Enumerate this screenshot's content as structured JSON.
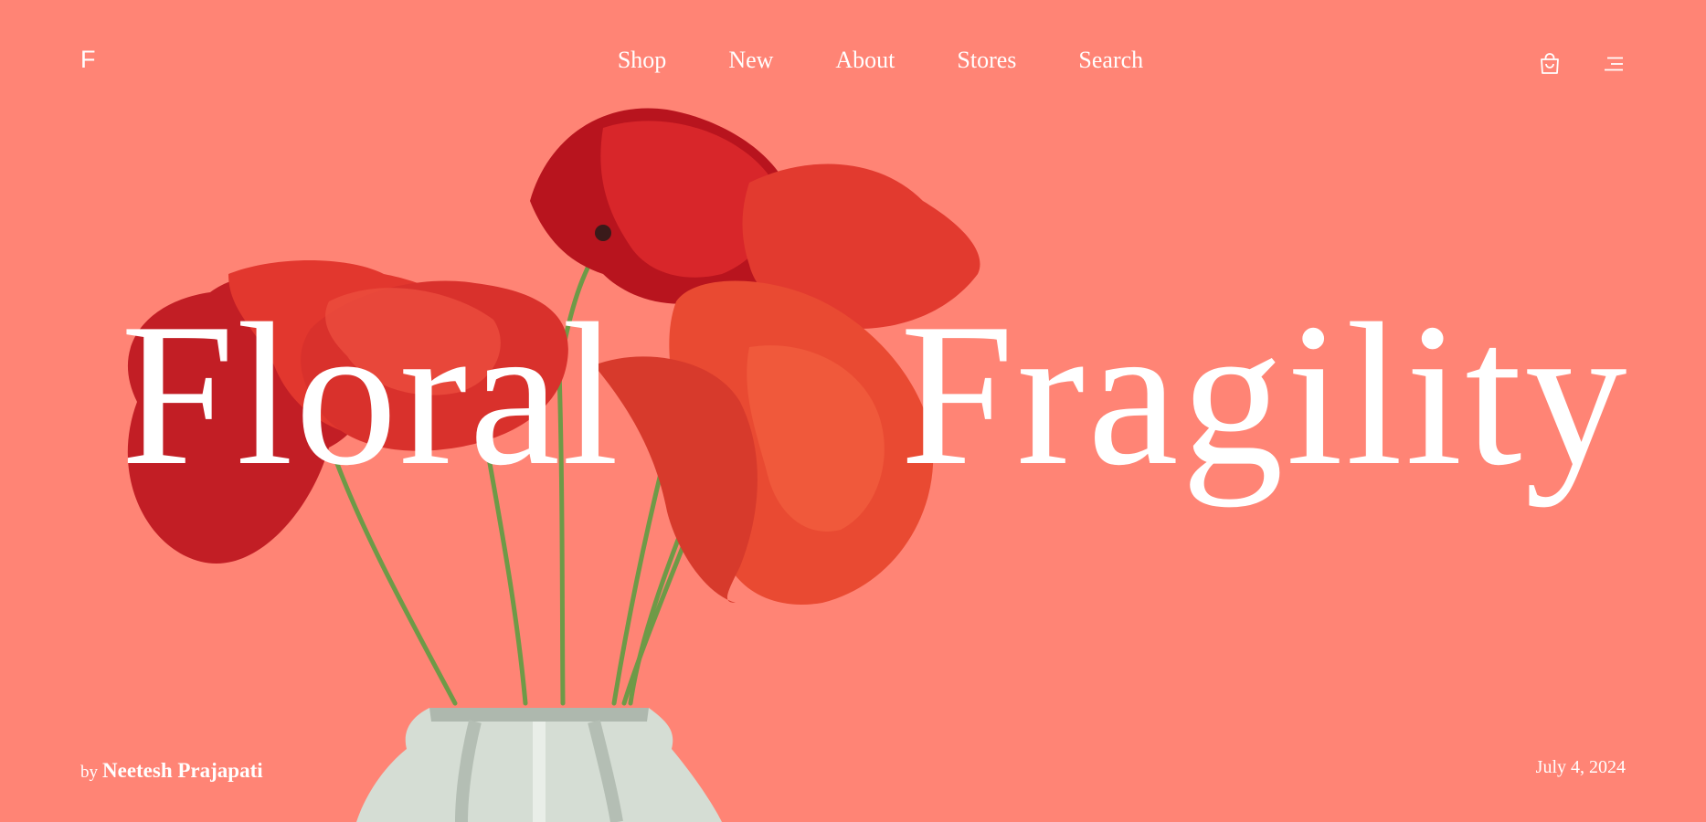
{
  "brand": {
    "logo": "F"
  },
  "nav": {
    "items": [
      "Shop",
      "New",
      "About",
      "Stores",
      "Search"
    ]
  },
  "header_icons": [
    "bag-icon",
    "menu-icon"
  ],
  "hero": {
    "title_word_1": "Floral",
    "title_word_2": "Fragility",
    "image": "red-poppies-in-white-vase"
  },
  "byline": {
    "prefix": "by",
    "author": "Neetesh Prajapati"
  },
  "date": "July 4, 2024",
  "colors": {
    "background": "#FF8475",
    "poppy": "#E1322D",
    "poppy_dark": "#B8141E",
    "stem": "#6E9A47",
    "vase": "#D5DDD4",
    "text": "#FFFFFF"
  }
}
